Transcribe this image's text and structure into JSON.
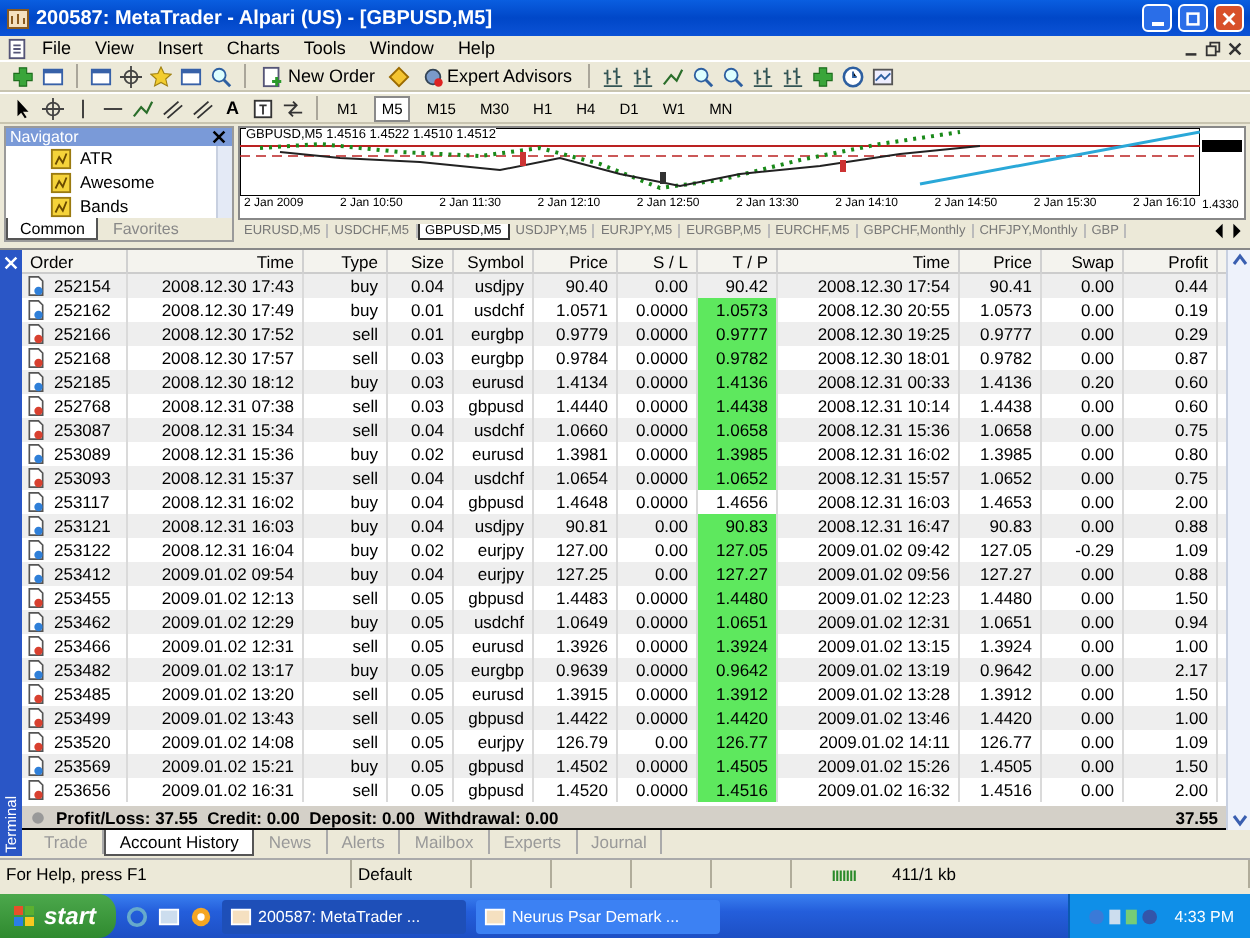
{
  "window": {
    "title": "200587: MetaTrader - Alpari (US) - [GBPUSD,M5]"
  },
  "menu": [
    "File",
    "View",
    "Insert",
    "Charts",
    "Tools",
    "Window",
    "Help"
  ],
  "toolbar": {
    "buttons": [
      "New Order",
      "Expert Advisors"
    ],
    "text_tool": "A",
    "timeframes": [
      {
        "label": "M1",
        "selected": false
      },
      {
        "label": "M5",
        "selected": true
      },
      {
        "label": "M15",
        "selected": false
      },
      {
        "label": "M30",
        "selected": false
      },
      {
        "label": "H1",
        "selected": false
      },
      {
        "label": "H4",
        "selected": false
      },
      {
        "label": "D1",
        "selected": false
      },
      {
        "label": "W1",
        "selected": false
      },
      {
        "label": "MN",
        "selected": false
      }
    ]
  },
  "navigator": {
    "title": "Navigator",
    "items": [
      "ATR",
      "Awesome",
      "Bands"
    ],
    "tabs": [
      {
        "label": "Common",
        "selected": true
      },
      {
        "label": "Favorites",
        "selected": false
      }
    ]
  },
  "chart": {
    "header": "GBPUSD,M5  1.4516 1.4522 1.4510 1.4512",
    "price_label": "1.4330",
    "time_labels": [
      "2 Jan 2009",
      "2 Jan 10:50",
      "2 Jan 11:30",
      "2 Jan 12:10",
      "2 Jan 12:50",
      "2 Jan 13:30",
      "2 Jan 14:10",
      "2 Jan 14:50",
      "2 Jan 15:30",
      "2 Jan 16:10"
    ]
  },
  "chart_tabs": [
    {
      "label": "EURUSD,M5",
      "selected": false
    },
    {
      "label": "USDCHF,M5",
      "selected": false
    },
    {
      "label": "GBPUSD,M5",
      "selected": true
    },
    {
      "label": "USDJPY,M5",
      "selected": false
    },
    {
      "label": "EURJPY,M5",
      "selected": false
    },
    {
      "label": "EURGBP,M5",
      "selected": false
    },
    {
      "label": "EURCHF,M5",
      "selected": false
    },
    {
      "label": "GBPCHF,Monthly",
      "selected": false
    },
    {
      "label": "CHFJPY,Monthly",
      "selected": false
    },
    {
      "label": "GBP",
      "selected": false
    }
  ],
  "terminal": {
    "title": "Terminal",
    "columns": [
      "Order",
      "Time",
      "Type",
      "Size",
      "Symbol",
      "Price",
      "S / L",
      "T / P",
      "Time",
      "Price",
      "Swap",
      "Profit"
    ],
    "rows": [
      {
        "kind": "buy",
        "tp_hit": false,
        "cells": [
          "252154",
          "2008.12.30 17:43",
          "buy",
          "0.04",
          "usdjpy",
          "90.40",
          "0.00",
          "90.42",
          "2008.12.30 17:54",
          "90.41",
          "0.00",
          "0.44"
        ]
      },
      {
        "kind": "buy",
        "tp_hit": true,
        "cells": [
          "252162",
          "2008.12.30 17:49",
          "buy",
          "0.01",
          "usdchf",
          "1.0571",
          "0.0000",
          "1.0573",
          "2008.12.30 20:55",
          "1.0573",
          "0.00",
          "0.19"
        ]
      },
      {
        "kind": "sell",
        "tp_hit": true,
        "cells": [
          "252166",
          "2008.12.30 17:52",
          "sell",
          "0.01",
          "eurgbp",
          "0.9779",
          "0.0000",
          "0.9777",
          "2008.12.30 19:25",
          "0.9777",
          "0.00",
          "0.29"
        ]
      },
      {
        "kind": "sell",
        "tp_hit": true,
        "cells": [
          "252168",
          "2008.12.30 17:57",
          "sell",
          "0.03",
          "eurgbp",
          "0.9784",
          "0.0000",
          "0.9782",
          "2008.12.30 18:01",
          "0.9782",
          "0.00",
          "0.87"
        ]
      },
      {
        "kind": "buy",
        "tp_hit": true,
        "cells": [
          "252185",
          "2008.12.30 18:12",
          "buy",
          "0.03",
          "eurusd",
          "1.4134",
          "0.0000",
          "1.4136",
          "2008.12.31 00:33",
          "1.4136",
          "0.20",
          "0.60"
        ]
      },
      {
        "kind": "sell",
        "tp_hit": true,
        "cells": [
          "252768",
          "2008.12.31 07:38",
          "sell",
          "0.03",
          "gbpusd",
          "1.4440",
          "0.0000",
          "1.4438",
          "2008.12.31 10:14",
          "1.4438",
          "0.00",
          "0.60"
        ]
      },
      {
        "kind": "sell",
        "tp_hit": true,
        "cells": [
          "253087",
          "2008.12.31 15:34",
          "sell",
          "0.04",
          "usdchf",
          "1.0660",
          "0.0000",
          "1.0658",
          "2008.12.31 15:36",
          "1.0658",
          "0.00",
          "0.75"
        ]
      },
      {
        "kind": "buy",
        "tp_hit": true,
        "cells": [
          "253089",
          "2008.12.31 15:36",
          "buy",
          "0.02",
          "eurusd",
          "1.3981",
          "0.0000",
          "1.3985",
          "2008.12.31 16:02",
          "1.3985",
          "0.00",
          "0.80"
        ]
      },
      {
        "kind": "sell",
        "tp_hit": true,
        "cells": [
          "253093",
          "2008.12.31 15:37",
          "sell",
          "0.04",
          "usdchf",
          "1.0654",
          "0.0000",
          "1.0652",
          "2008.12.31 15:57",
          "1.0652",
          "0.00",
          "0.75"
        ]
      },
      {
        "kind": "buy",
        "tp_hit": false,
        "cells": [
          "253117",
          "2008.12.31 16:02",
          "buy",
          "0.04",
          "gbpusd",
          "1.4648",
          "0.0000",
          "1.4656",
          "2008.12.31 16:03",
          "1.4653",
          "0.00",
          "2.00"
        ]
      },
      {
        "kind": "buy",
        "tp_hit": true,
        "cells": [
          "253121",
          "2008.12.31 16:03",
          "buy",
          "0.04",
          "usdjpy",
          "90.81",
          "0.00",
          "90.83",
          "2008.12.31 16:47",
          "90.83",
          "0.00",
          "0.88"
        ]
      },
      {
        "kind": "buy",
        "tp_hit": true,
        "cells": [
          "253122",
          "2008.12.31 16:04",
          "buy",
          "0.02",
          "eurjpy",
          "127.00",
          "0.00",
          "127.05",
          "2009.01.02 09:42",
          "127.05",
          "-0.29",
          "1.09"
        ]
      },
      {
        "kind": "buy",
        "tp_hit": true,
        "cells": [
          "253412",
          "2009.01.02 09:54",
          "buy",
          "0.04",
          "eurjpy",
          "127.25",
          "0.00",
          "127.27",
          "2009.01.02 09:56",
          "127.27",
          "0.00",
          "0.88"
        ]
      },
      {
        "kind": "sell",
        "tp_hit": true,
        "cells": [
          "253455",
          "2009.01.02 12:13",
          "sell",
          "0.05",
          "gbpusd",
          "1.4483",
          "0.0000",
          "1.4480",
          "2009.01.02 12:23",
          "1.4480",
          "0.00",
          "1.50"
        ]
      },
      {
        "kind": "buy",
        "tp_hit": true,
        "cells": [
          "253462",
          "2009.01.02 12:29",
          "buy",
          "0.05",
          "usdchf",
          "1.0649",
          "0.0000",
          "1.0651",
          "2009.01.02 12:31",
          "1.0651",
          "0.00",
          "0.94"
        ]
      },
      {
        "kind": "sell",
        "tp_hit": true,
        "cells": [
          "253466",
          "2009.01.02 12:31",
          "sell",
          "0.05",
          "eurusd",
          "1.3926",
          "0.0000",
          "1.3924",
          "2009.01.02 13:15",
          "1.3924",
          "0.00",
          "1.00"
        ]
      },
      {
        "kind": "buy",
        "tp_hit": true,
        "cells": [
          "253482",
          "2009.01.02 13:17",
          "buy",
          "0.05",
          "eurgbp",
          "0.9639",
          "0.0000",
          "0.9642",
          "2009.01.02 13:19",
          "0.9642",
          "0.00",
          "2.17"
        ]
      },
      {
        "kind": "sell",
        "tp_hit": true,
        "cells": [
          "253485",
          "2009.01.02 13:20",
          "sell",
          "0.05",
          "eurusd",
          "1.3915",
          "0.0000",
          "1.3912",
          "2009.01.02 13:28",
          "1.3912",
          "0.00",
          "1.50"
        ]
      },
      {
        "kind": "sell",
        "tp_hit": true,
        "cells": [
          "253499",
          "2009.01.02 13:43",
          "sell",
          "0.05",
          "gbpusd",
          "1.4422",
          "0.0000",
          "1.4420",
          "2009.01.02 13:46",
          "1.4420",
          "0.00",
          "1.00"
        ]
      },
      {
        "kind": "sell",
        "tp_hit": true,
        "cells": [
          "253520",
          "2009.01.02 14:08",
          "sell",
          "0.05",
          "eurjpy",
          "126.79",
          "0.00",
          "126.77",
          "2009.01.02 14:11",
          "126.77",
          "0.00",
          "1.09"
        ]
      },
      {
        "kind": "buy",
        "tp_hit": true,
        "cells": [
          "253569",
          "2009.01.02 15:21",
          "buy",
          "0.05",
          "gbpusd",
          "1.4502",
          "0.0000",
          "1.4505",
          "2009.01.02 15:26",
          "1.4505",
          "0.00",
          "1.50"
        ]
      },
      {
        "kind": "sell",
        "tp_hit": true,
        "cells": [
          "253656",
          "2009.01.02 16:31",
          "sell",
          "0.05",
          "gbpusd",
          "1.4520",
          "0.0000",
          "1.4516",
          "2009.01.02 16:32",
          "1.4516",
          "0.00",
          "2.00"
        ]
      }
    ],
    "summary": "Profit/Loss: 37.55  Credit: 0.00  Deposit: 0.00  Withdrawal: 0.00",
    "total": "37.55",
    "tabs": [
      {
        "label": "Trade",
        "selected": false
      },
      {
        "label": "Account History",
        "selected": true
      },
      {
        "label": "News",
        "selected": false
      },
      {
        "label": "Alerts",
        "selected": false
      },
      {
        "label": "Mailbox",
        "selected": false
      },
      {
        "label": "Experts",
        "selected": false
      },
      {
        "label": "Journal",
        "selected": false
      }
    ]
  },
  "status_bar": {
    "help": "For Help, press F1",
    "profile": "Default",
    "traffic": "411/1 kb"
  },
  "taskbar": {
    "start": "start",
    "windows": [
      {
        "label": "200587: MetaTrader ...",
        "selected": true
      },
      {
        "label": "Neurus Psar Demark ...",
        "selected": false
      }
    ],
    "clock": "4:33 PM"
  }
}
